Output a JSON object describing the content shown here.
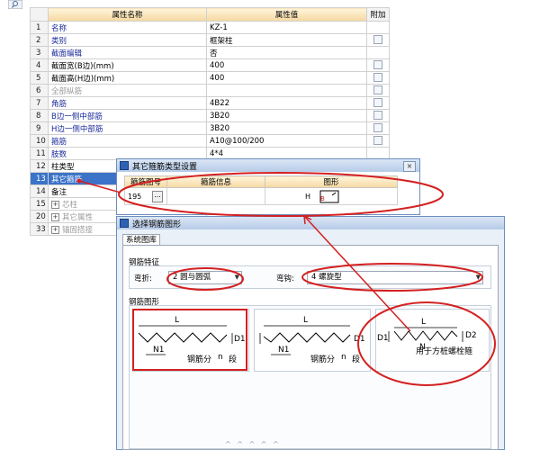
{
  "left_icon": "search-icon",
  "table": {
    "headers": {
      "num": "",
      "name": "属性名称",
      "value": "属性值",
      "extra": "附加"
    },
    "rows": [
      {
        "num": "1",
        "name": "名称",
        "value": "KZ-1",
        "checkbox": false,
        "style": "blue"
      },
      {
        "num": "2",
        "name": "类别",
        "value": "框架柱",
        "checkbox": true,
        "style": "blue"
      },
      {
        "num": "3",
        "name": "截面编辑",
        "value": "否",
        "checkbox": false,
        "style": "blue"
      },
      {
        "num": "4",
        "name": "截面宽(B边)(mm)",
        "value": "400",
        "checkbox": true,
        "style": "plain"
      },
      {
        "num": "5",
        "name": "截面高(H边)(mm)",
        "value": "400",
        "checkbox": true,
        "style": "plain"
      },
      {
        "num": "6",
        "name": "全部纵筋",
        "value": "",
        "checkbox": true,
        "style": "gray"
      },
      {
        "num": "7",
        "name": "角筋",
        "value": "4B22",
        "checkbox": true,
        "style": "blue"
      },
      {
        "num": "8",
        "name": "B边一侧中部筋",
        "value": "3B20",
        "checkbox": true,
        "style": "blue"
      },
      {
        "num": "9",
        "name": "H边一侧中部筋",
        "value": "3B20",
        "checkbox": true,
        "style": "blue"
      },
      {
        "num": "10",
        "name": "箍筋",
        "value": "A10@100/200",
        "checkbox": true,
        "style": "blue"
      },
      {
        "num": "11",
        "name": "肢数",
        "value": "4*4",
        "checkbox": false,
        "style": "blue"
      },
      {
        "num": "12",
        "name": "柱类型",
        "value": "",
        "checkbox": false,
        "style": "plain"
      },
      {
        "num": "13",
        "name": "其它箍筋",
        "value": "",
        "checkbox": false,
        "style": "selected"
      },
      {
        "num": "14",
        "name": "备注",
        "value": "",
        "checkbox": false,
        "style": "plain"
      },
      {
        "num": "15",
        "name": "芯柱",
        "value": "",
        "checkbox": false,
        "style": "gray",
        "expander": "+"
      },
      {
        "num": "20",
        "name": "其它属性",
        "value": "",
        "checkbox": false,
        "style": "gray",
        "expander": "+"
      },
      {
        "num": "33",
        "name": "锚固搭接",
        "value": "",
        "checkbox": false,
        "style": "gray",
        "expander": "+"
      }
    ]
  },
  "dialog1": {
    "title": "其它箍筋类型设置",
    "close_label": "×",
    "headers": {
      "num": "箍筋图号",
      "info": "箍筋信息",
      "shape": "图形"
    },
    "row": {
      "num": "195",
      "info": "",
      "ellipsis": "...",
      "shape_letter": "H",
      "shape_mark": "B"
    }
  },
  "dialog2": {
    "title": "选择钢筋图形",
    "tab": "系统图库",
    "features_label": "钢筋特征",
    "bend_label": "弯折:",
    "bend_value": "2 圆与圆弧",
    "hook_label": "弯钩:",
    "hook_value": "4 螺旋型",
    "shapes_label": "钢筋图形",
    "shapes": [
      {
        "L": "L",
        "N1": "N1",
        "D1": "D1",
        "text": "钢筋分",
        "n": "n",
        "seg": "段"
      },
      {
        "L": "L",
        "N1": "N1",
        "D1": "D1",
        "text": "钢筋分",
        "n": "n",
        "seg": "段"
      },
      {
        "L": "L",
        "N": "N",
        "D1": "D1",
        "D2": "D2",
        "text": "用于方桩螺栓箍"
      }
    ]
  },
  "footer": "^ ^ ^ ^ ^",
  "colors": {
    "highlight": "#d42020",
    "selection": "#3b73c9",
    "header_gradient": "#f5d8a0"
  }
}
